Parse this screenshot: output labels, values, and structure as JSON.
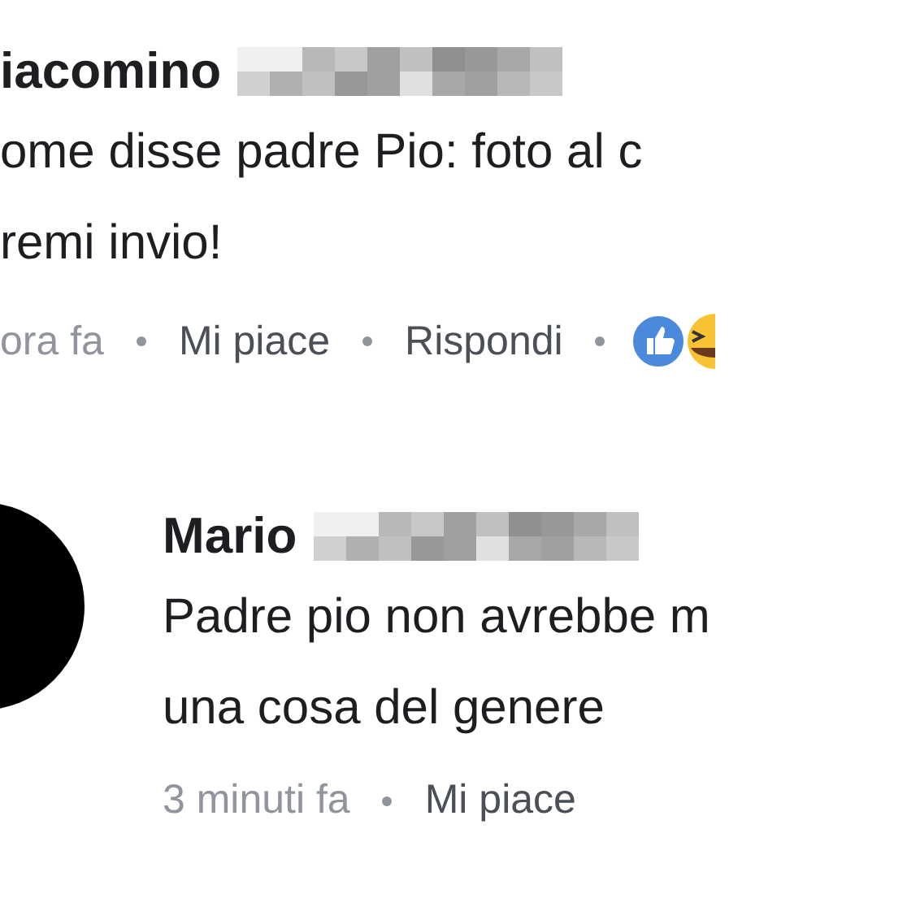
{
  "comments": [
    {
      "author": "iacomino",
      "avatar": false,
      "lines": [
        "ome disse padre Pio: foto al c",
        "remi invio!"
      ],
      "time": "ora fa",
      "actions": [
        "Mi piace",
        "Rispondi"
      ],
      "reactions": true
    },
    {
      "author": "Mario",
      "avatar": true,
      "lines": [
        "Padre pio non avrebbe m",
        "una cosa del genere"
      ],
      "time": "3 minuti fa",
      "actions": [
        "Mi piace"
      ],
      "reactions": false
    }
  ]
}
